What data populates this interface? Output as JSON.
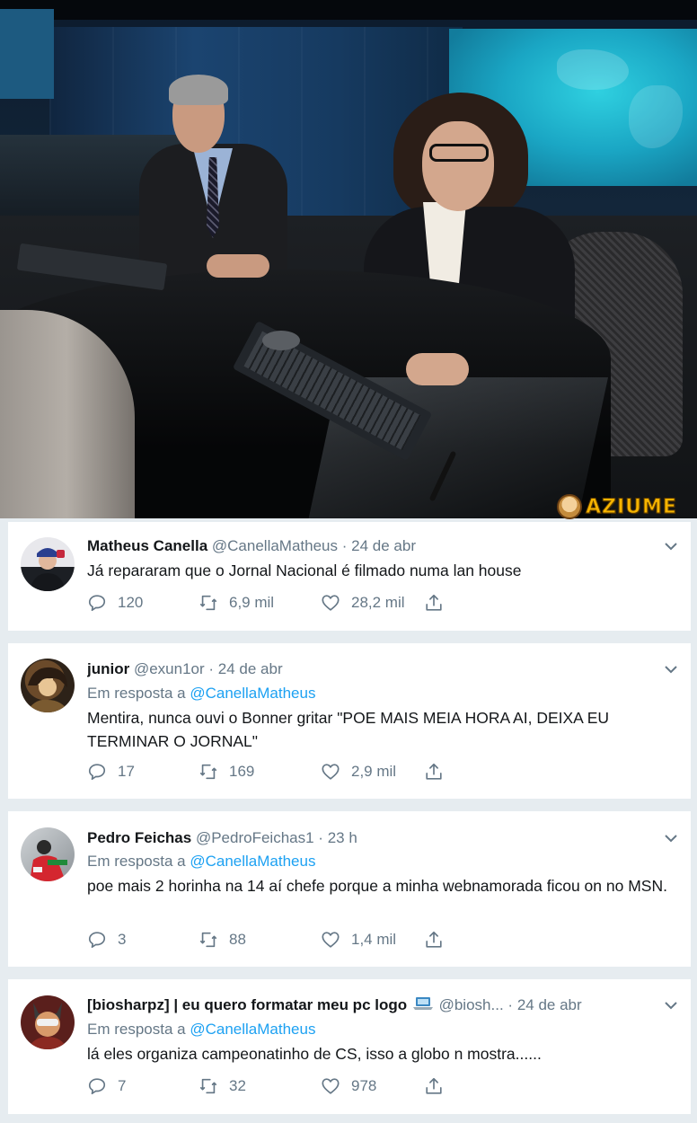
{
  "watermark": {
    "text": "AZIUME"
  },
  "tweets": [
    {
      "name": "Matheus Canella",
      "handle": "@CanellaMatheus",
      "dot": "·",
      "time": "24 de abr",
      "reply_prefix": "",
      "reply_mention": "",
      "text": "Já repararam que o Jornal Nacional é filmado numa lan house",
      "replies": "120",
      "retweets": "6,9 mil",
      "likes": "28,2 mil"
    },
    {
      "name": "junior",
      "handle": "@exun1or",
      "dot": "·",
      "time": "24 de abr",
      "reply_prefix": "Em resposta a",
      "reply_mention": "@CanellaMatheus",
      "text": "Mentira, nunca ouvi o Bonner gritar \"POE MAIS MEIA HORA AI, DEIXA EU TERMINAR O JORNAL\"",
      "replies": "17",
      "retweets": "169",
      "likes": "2,9 mil"
    },
    {
      "name": "Pedro Feichas",
      "handle": "@PedroFeichas1",
      "dot": "·",
      "time": "23 h",
      "reply_prefix": "Em resposta a",
      "reply_mention": "@CanellaMatheus",
      "text": "poe mais 2 horinha na 14 aí chefe porque a minha webnamorada ficou on no MSN.",
      "replies": "3",
      "retweets": "88",
      "likes": "1,4 mil"
    },
    {
      "name": "[biosharpz] | eu quero formatar meu pc logo",
      "handle": "@biosh...",
      "dot": "·",
      "time": "24 de abr",
      "reply_prefix": "Em resposta a",
      "reply_mention": "@CanellaMatheus",
      "text": "lá eles organiza campeonatinho de CS, isso a globo n mostra......",
      "replies": "7",
      "retweets": "32",
      "likes": "978"
    }
  ],
  "icons": {
    "reply": "reply-icon",
    "retweet": "retweet-icon",
    "like": "heart-icon",
    "share": "share-icon",
    "caret": "chevron-down-icon",
    "laptop": "laptop-emoji-icon"
  },
  "colors": {
    "page_bg": "#e6ecf0",
    "card_bg": "#ffffff",
    "name": "#14171a",
    "muted": "#657786",
    "mention": "#1da1f2"
  }
}
